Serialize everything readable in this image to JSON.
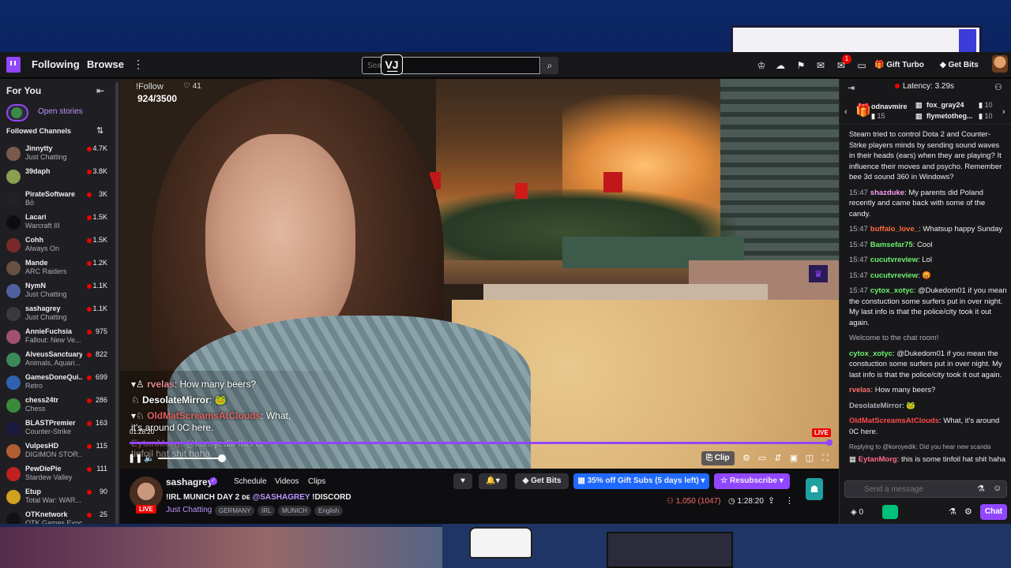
{
  "nav": {
    "following": "Following",
    "browse": "Browse",
    "more": "⋮",
    "search_placeholder": "Search",
    "search_overlay": "V͟J",
    "notifications_count": "1",
    "gift_turbo": "Gift Turbo",
    "get_bits": "Get Bits"
  },
  "sidebar": {
    "for_you": "For You",
    "open_stories": "Open stories",
    "followed_channels": "Followed Channels",
    "channels": [
      {
        "name": "Jinnytty",
        "game": "Just Chatting",
        "viewers": "4.7K",
        "color": "#7a5a4a"
      },
      {
        "name": "39daph",
        "game": "",
        "viewers": "3.8K",
        "color": "#8aa050"
      },
      {
        "name": "PirateSoftware",
        "game": "Bō",
        "viewers": "3K",
        "color": "#222"
      },
      {
        "name": "Lacari",
        "game": "Warcraft III",
        "viewers": "1.5K",
        "color": "#0e0e10"
      },
      {
        "name": "Cohh",
        "game": "Always On",
        "viewers": "1.5K",
        "color": "#7a2a2a"
      },
      {
        "name": "Mande",
        "game": "ARC Raiders",
        "viewers": "1.2K",
        "color": "#6a5040"
      },
      {
        "name": "NymN",
        "game": "Just Chatting",
        "viewers": "1.1K",
        "color": "#5060a0"
      },
      {
        "name": "sashagrey",
        "game": "Just Chatting",
        "viewers": "1.1K",
        "color": "#3a3a3e"
      },
      {
        "name": "AnnieFuchsia",
        "game": "Fallout: New Ve...",
        "viewers": "975",
        "color": "#a05070"
      },
      {
        "name": "AlveusSanctuary",
        "game": "Animals, Aquari...",
        "viewers": "822",
        "color": "#3a8a5a"
      },
      {
        "name": "GamesDoneQui...",
        "game": "Retro",
        "viewers": "699",
        "color": "#3060b0"
      },
      {
        "name": "chess24tr",
        "game": "Chess",
        "viewers": "286",
        "color": "#3a8a3a"
      },
      {
        "name": "BLASTPremier",
        "game": "Counter-Strike",
        "viewers": "163",
        "color": "#1a1a40"
      },
      {
        "name": "VulpesHD",
        "game": "DIGIMON STOR...",
        "viewers": "115",
        "color": "#b06030"
      },
      {
        "name": "PewDiePie",
        "game": "Stardew Valley",
        "viewers": "111",
        "color": "#c02020"
      },
      {
        "name": "Etup",
        "game": "Total War: WAR...",
        "viewers": "90",
        "color": "#d0a020"
      },
      {
        "name": "OTKnetwork",
        "game": "OTK Games Expo",
        "viewers": "25",
        "color": "#111"
      }
    ]
  },
  "video": {
    "follow": "!Follow",
    "likes": "41",
    "goal": "924/3500",
    "timestamp": "01:28:20",
    "live": "LIVE",
    "clip": "Clip",
    "overlay_chat": [
      {
        "user": "rvelas",
        "text": "How many beers?",
        "color": "#e08a8a"
      },
      {
        "user": "DesolateMirror",
        "text": "🐸",
        "color": "#ffffff"
      },
      {
        "user": "OldMatScreamsAtClouds",
        "text": "What,",
        "color": "#e06060"
      },
      {
        "user": "",
        "text": "it's around 0C here.",
        "color": "#ffffff"
      },
      {
        "user": "EytanMorg",
        "text": "@koroyedik this is",
        "color": "#e08a8a"
      },
      {
        "user": "",
        "text": "tinfoil hat shit haha",
        "color": "#ffffff"
      }
    ]
  },
  "info": {
    "streamer": "sashagrey",
    "tabs": [
      "Schedule",
      "Videos",
      "Clips"
    ],
    "title_prefix": "!IRL MUNICH DAY 2 ᴅᴇ ",
    "title_mention": "@SASHAGREY",
    "title_suffix": " !DISCORD",
    "category": "Just Chatting",
    "tags": [
      "GERMANY",
      "IRL",
      "MUNICH",
      "English"
    ],
    "live": "LIVE",
    "get_bits": "Get Bits",
    "gift_subs": "35% off Gift Subs (5 days left)",
    "resubscribe": "Resubscribe",
    "viewers": "1,050 (1047)",
    "uptime": "1:28:20"
  },
  "chat": {
    "latency": "Latency: 3.29s",
    "gifters": [
      {
        "name": "odnavmire",
        "count": "15"
      },
      {
        "name": "fox_gray24",
        "count": "10"
      },
      {
        "name": "flymetotheg...",
        "count": "10"
      }
    ],
    "messages": [
      {
        "time": "",
        "user": "",
        "color": "#efeff1",
        "text": "Steam tried to control Dota 2 and Counter-Strke players minds by sending sound waves in their heads (ears) when they are playing? It influence their moves and psycho. Remember bee 3d sound 360 in Windows?"
      },
      {
        "time": "15:47",
        "user": "shazduke",
        "color": "#ff9cf0",
        "text": "My parents did Poland recently and came back with some of the candy."
      },
      {
        "time": "15:47",
        "user": "buffalo_love_",
        "color": "#ff6a3d",
        "text": "Whatsup happy Sunday"
      },
      {
        "time": "15:47",
        "user": "Bamsefar75",
        "color": "#6cf06c",
        "text": "Cool"
      },
      {
        "time": "15:47",
        "user": "cucutvreview",
        "color": "#6cf06c",
        "text": "Lol"
      },
      {
        "time": "15:47",
        "user": "cucutvreview",
        "color": "#6cf06c",
        "text": "😡"
      },
      {
        "time": "15:47",
        "user": "cytox_xotyc",
        "color": "#6cf06c",
        "text": "@Dukedom01 if you mean the constuction some surfers put in over night. My last info is that the police/city took it out again."
      }
    ],
    "welcome": "Welcome to the chat room!",
    "after": [
      {
        "time": "",
        "user": "cytox_xotyc",
        "color": "#6cf06c",
        "text": "@Dukedom01 if you mean the constuction some surfers put in over night. My last info is that the police/city took it out again."
      },
      {
        "time": "",
        "user": "rvelas",
        "color": "#ff6b6b",
        "text": "How many beers?"
      },
      {
        "time": "",
        "user": "DesolateMirror",
        "color": "#adadb8",
        "text": "🐸"
      },
      {
        "time": "",
        "user": "OldMatScreamsAtClouds",
        "color": "#ff4a4a",
        "text": "What, it's around 0C here."
      }
    ],
    "reply_ctx": "Replying to @koroyedik: Did you hear new scanda",
    "reply": {
      "user": "EytanMorg",
      "color": "#ff6b8a",
      "text": "this is some tinfoil hat shit haha"
    },
    "input_placeholder": "Send a message",
    "points": "0",
    "chat_btn": "Chat"
  }
}
